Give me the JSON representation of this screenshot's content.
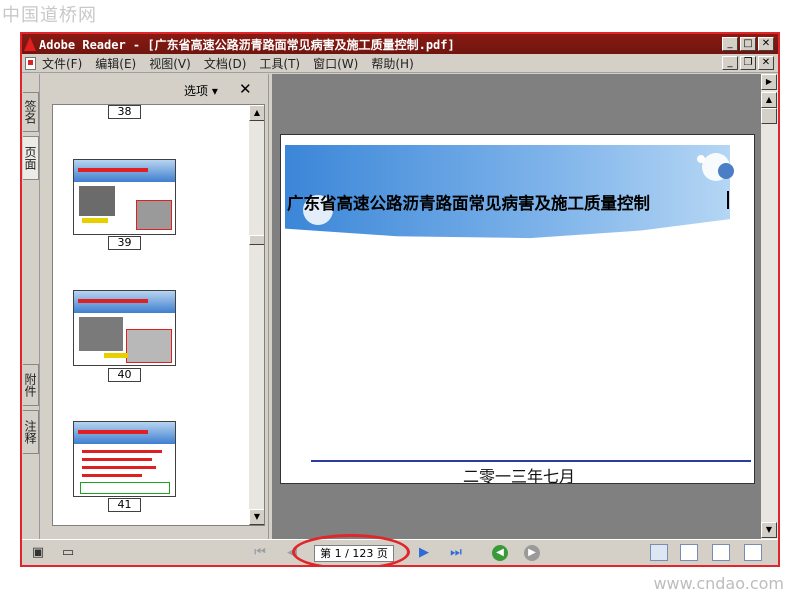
{
  "watermarks": {
    "top": "中国道桥网",
    "bottom": "www.cndao.com"
  },
  "window": {
    "title": "Adobe Reader - [广东省高速公路沥青路面常见病害及施工质量控制.pdf]",
    "buttons": {
      "minimize": "_",
      "maximize": "□",
      "close": "✕",
      "restore": "❐"
    }
  },
  "menu": {
    "items": [
      "文件(F)",
      "编辑(E)",
      "视图(V)",
      "文档(D)",
      "工具(T)",
      "窗口(W)",
      "帮助(H)"
    ]
  },
  "side_tabs": {
    "signatures": "签名",
    "pages": "页面",
    "attachments": "附件",
    "comments": "注释"
  },
  "nav_panel": {
    "options": "选项 ▾",
    "close": "✕"
  },
  "thumbnails": [
    {
      "label": "38"
    },
    {
      "label": "39"
    },
    {
      "label": "40"
    },
    {
      "label": "41"
    }
  ],
  "document": {
    "title": "广东省高速公路沥青路面常见病害及施工质量控制",
    "date": "二零一三年七月"
  },
  "toolbar": {
    "page_indicator": "第 1 / 123 页"
  },
  "colors": {
    "accent": "#e0262a",
    "title_bar": "#7a1a12",
    "banner_blue": "#3b86d8"
  }
}
